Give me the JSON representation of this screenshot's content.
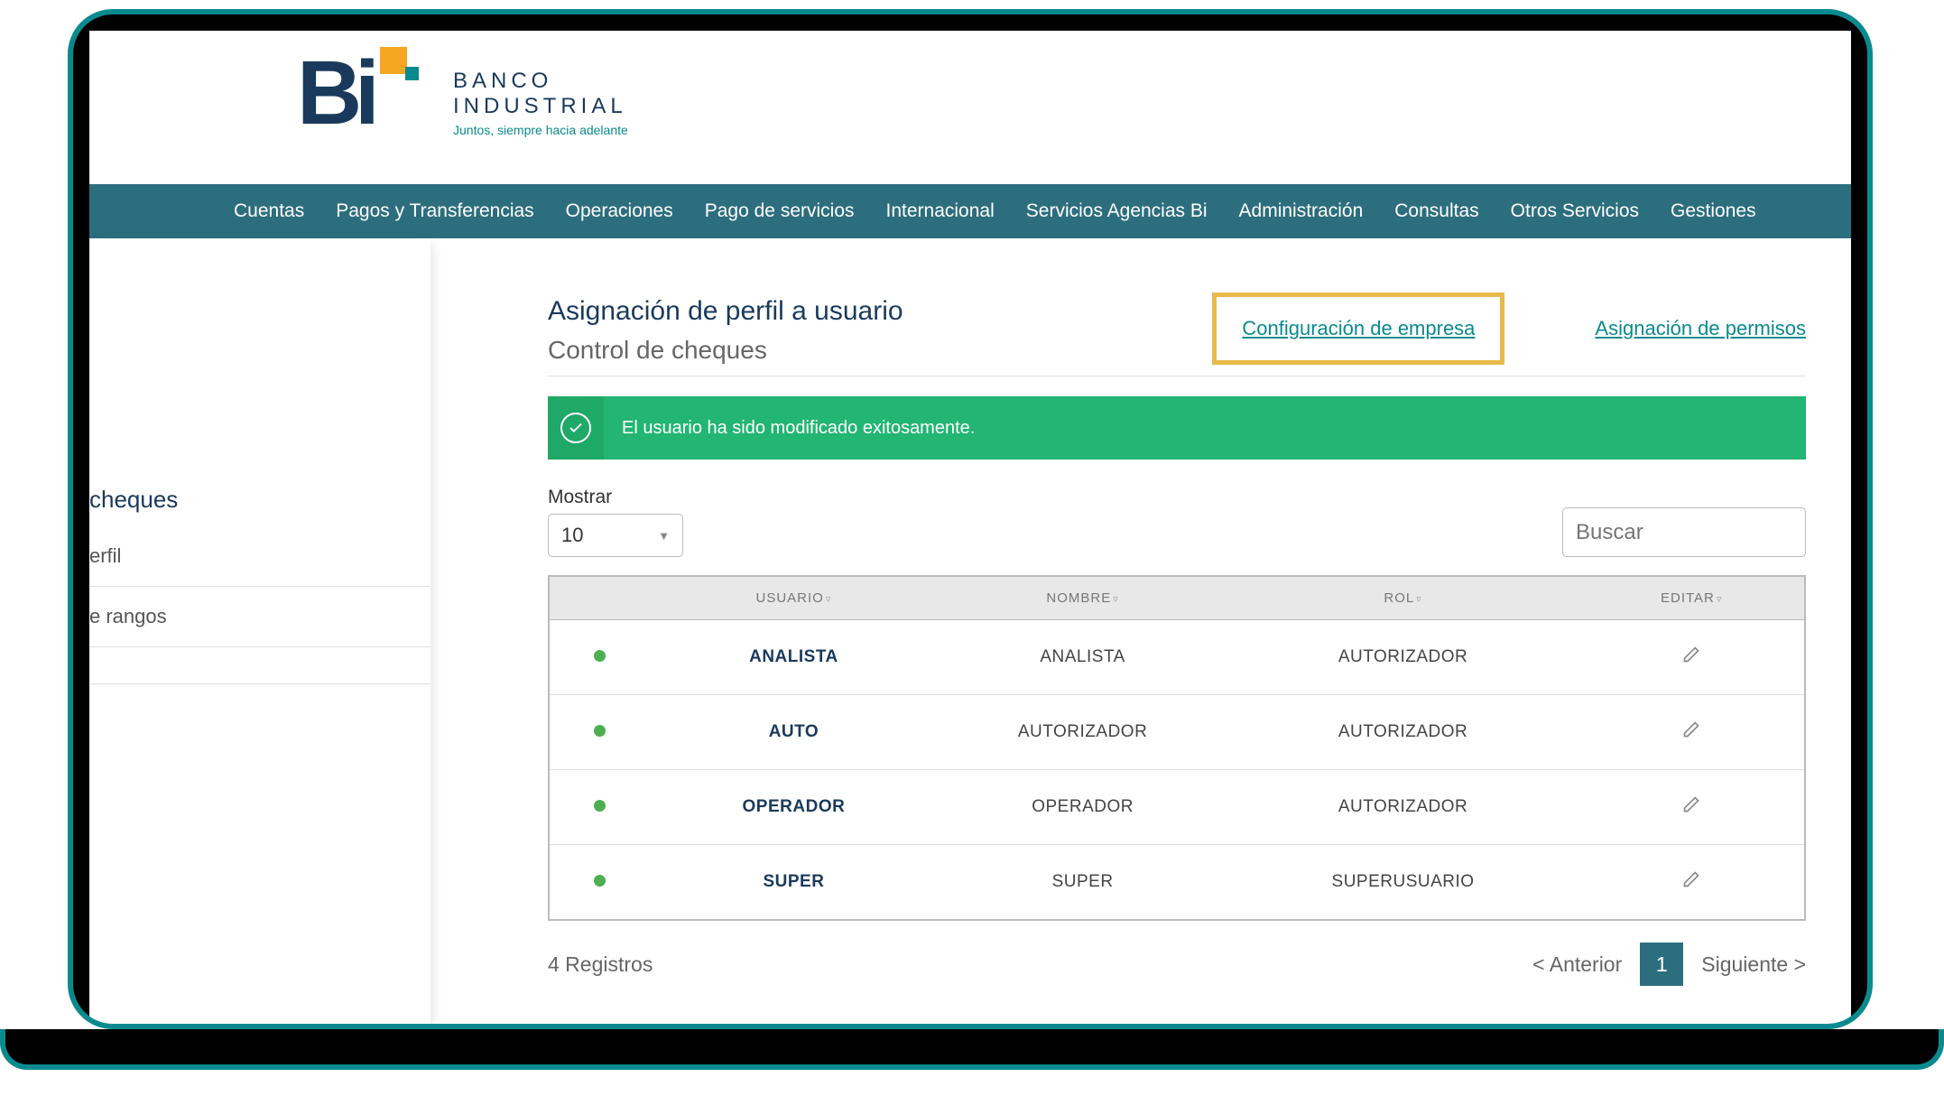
{
  "brand": {
    "line1": "BANCO",
    "line2": "INDUSTRIAL",
    "tagline": "Juntos, siempre hacia adelante"
  },
  "nav": {
    "items": [
      "Cuentas",
      "Pagos y Transferencias",
      "Operaciones",
      "Pago de servicios",
      "Internacional",
      "Servicios Agencias Bi",
      "Administración",
      "Consultas",
      "Otros Servicios",
      "Gestiones"
    ]
  },
  "sidebar": {
    "title_fragment": "cheques",
    "items": [
      "erfil",
      "e rangos"
    ]
  },
  "page": {
    "title": "Asignación de perfil a usuario",
    "subtitle": "Control de cheques",
    "link_config": "Configuración de empresa",
    "link_permisos": "Asignación de permisos"
  },
  "alert": {
    "message": "El usuario ha sido modificado exitosamente."
  },
  "controls": {
    "mostrar_label": "Mostrar",
    "page_size": "10",
    "search_placeholder": "Buscar"
  },
  "table": {
    "headers": {
      "usuario": "USUARIO",
      "nombre": "NOMBRE",
      "rol": "ROL",
      "editar": "EDITAR"
    },
    "rows": [
      {
        "usuario": "ANALISTA",
        "nombre": "ANALISTA",
        "rol": "AUTORIZADOR"
      },
      {
        "usuario": "AUTO",
        "nombre": "AUTORIZADOR",
        "rol": "AUTORIZADOR"
      },
      {
        "usuario": "OPERADOR",
        "nombre": "OPERADOR",
        "rol": "AUTORIZADOR"
      },
      {
        "usuario": "SUPER",
        "nombre": "SUPER",
        "rol": "SUPERUSUARIO"
      }
    ]
  },
  "footer": {
    "count_text": "4 Registros",
    "prev": "< Anterior",
    "page": "1",
    "next": "Siguiente >"
  }
}
